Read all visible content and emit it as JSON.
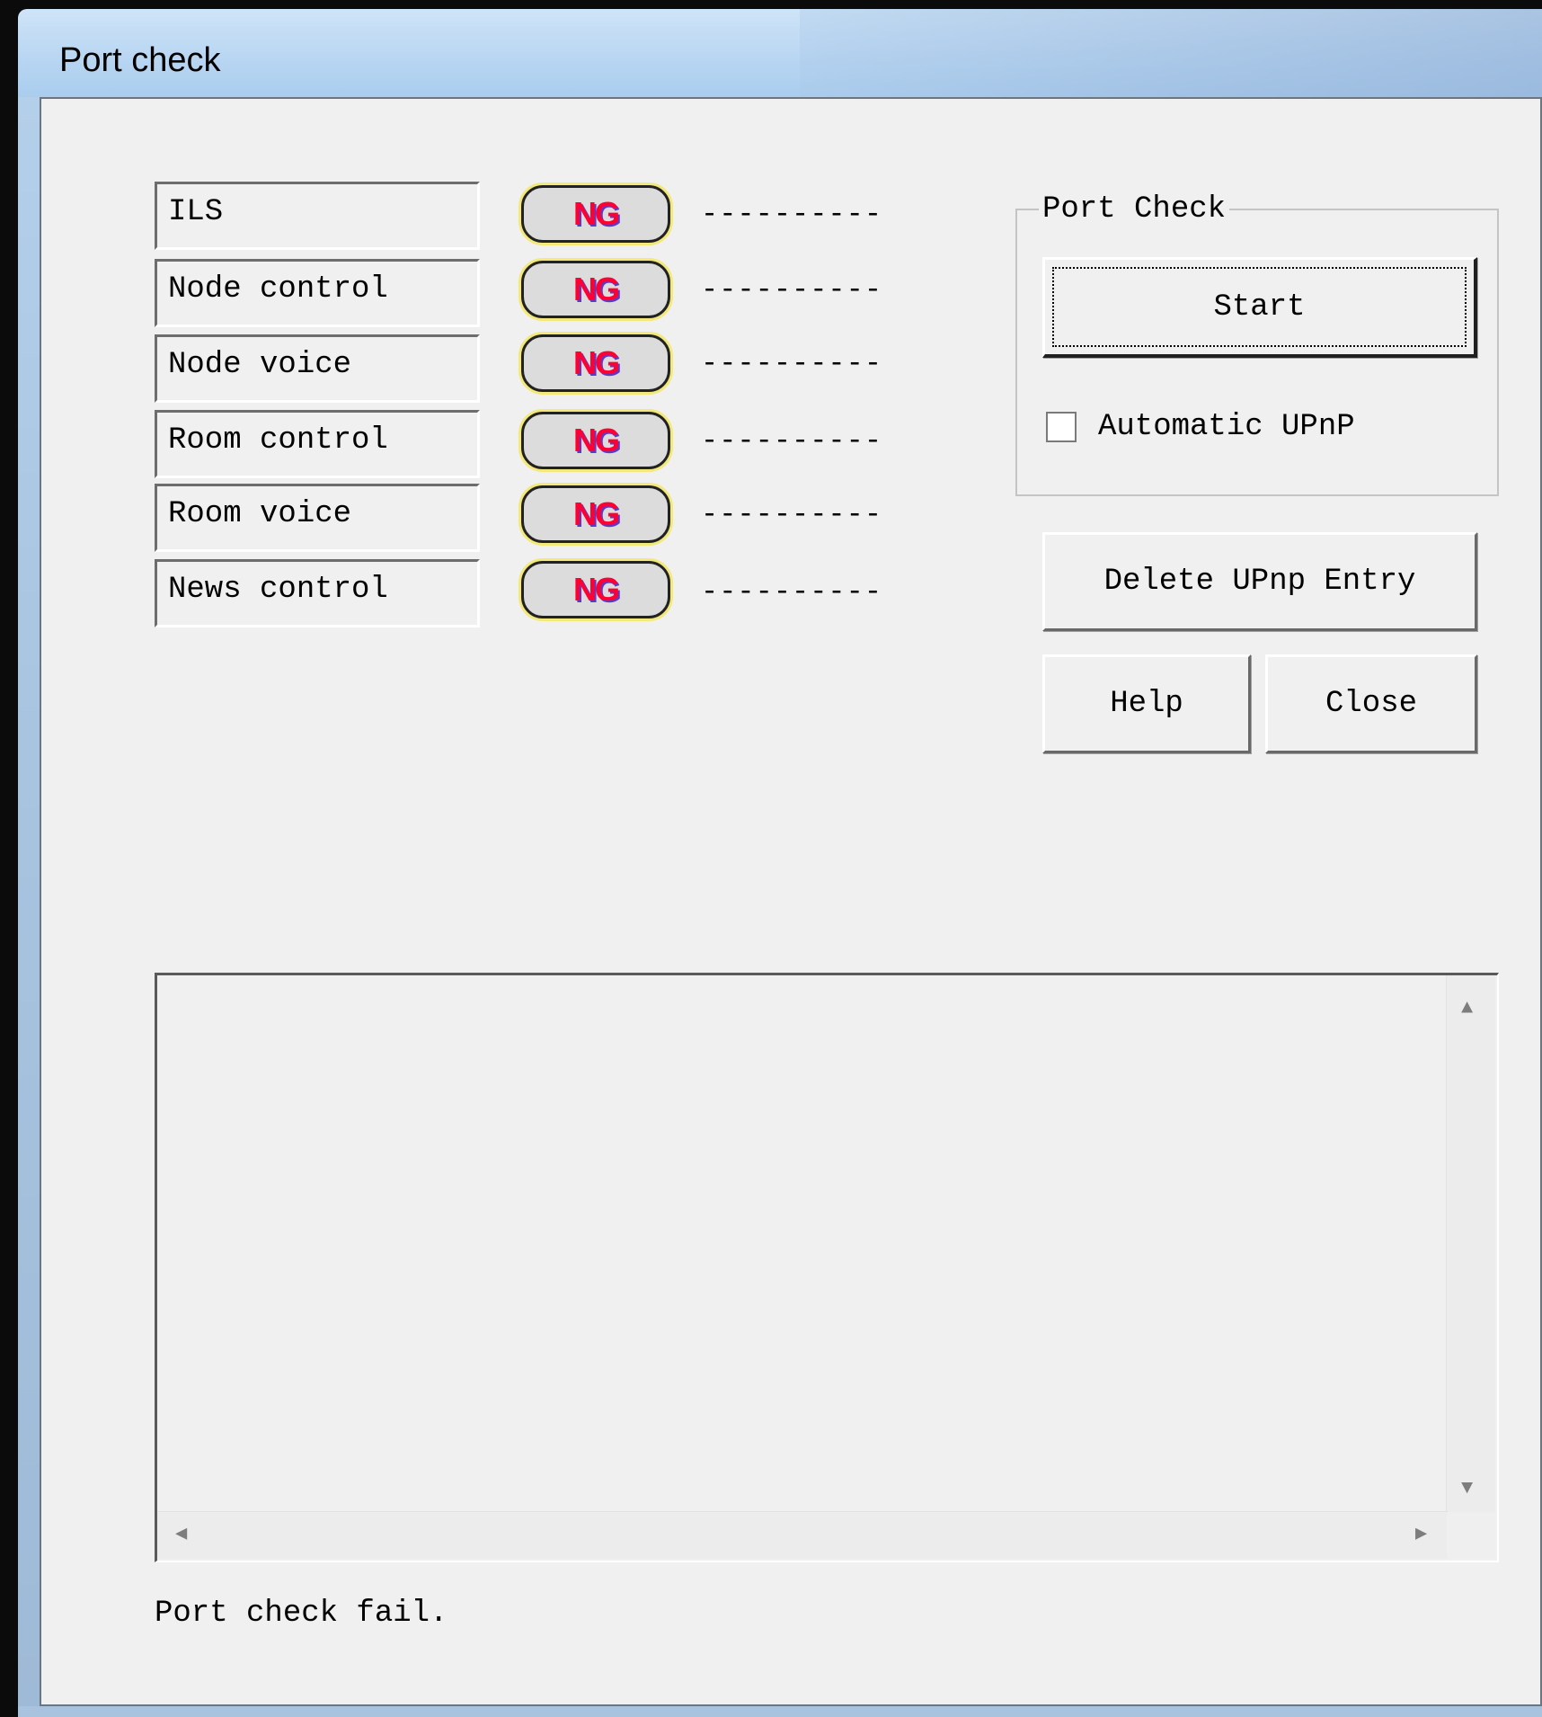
{
  "window": {
    "title": "Port check"
  },
  "rows": [
    {
      "label": "ILS",
      "status": "NG",
      "detail": "----------"
    },
    {
      "label": "Node control",
      "status": "NG",
      "detail": "----------"
    },
    {
      "label": "Node voice",
      "status": "NG",
      "detail": "----------"
    },
    {
      "label": "Room control",
      "status": "NG",
      "detail": "----------"
    },
    {
      "label": "Room voice",
      "status": "NG",
      "detail": "----------"
    },
    {
      "label": "News control",
      "status": "NG",
      "detail": "----------"
    }
  ],
  "port_check_group": {
    "legend": "Port Check",
    "start_label": "Start",
    "automatic_upnp_label": "Automatic UPnP",
    "automatic_upnp_checked": false
  },
  "buttons": {
    "delete_upnp": "Delete UPnp Entry",
    "help": "Help",
    "close": "Close"
  },
  "log": {
    "text": ""
  },
  "status_text": "Port check fail.",
  "colors": {
    "ng_text": "#ff0033",
    "ng_shadow": "#5a3bc9",
    "ng_ring": "#f3e87a",
    "titlebar": "#bcd8f3"
  }
}
